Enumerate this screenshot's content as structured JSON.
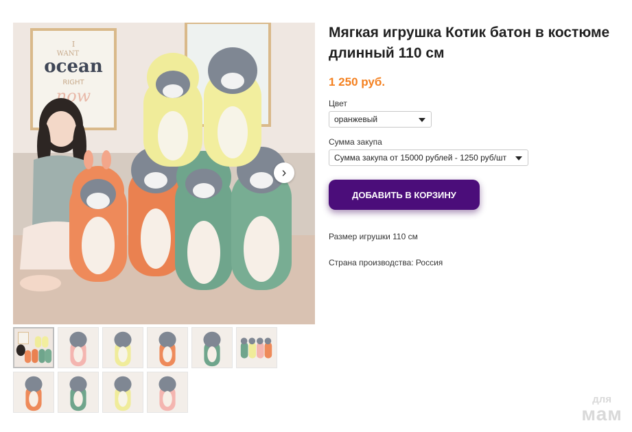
{
  "product": {
    "title": "Мягкая игрушка Котик батон в костюме длинный 110 см",
    "price": "1 250 руб.",
    "color_label": "Цвет",
    "color_value": "оранжевый",
    "sum_label": "Сумма закупа",
    "sum_value": "Сумма закупа от 15000 рублей - 1250 руб/шт",
    "add_to_cart": "ДОБАВИТЬ В КОРЗИНУ",
    "size_text": "Размер игрушки 110 см",
    "country_text": "Страна производства: Россия"
  },
  "gallery": {
    "poster_lines": [
      "I",
      "WANT",
      "ocean",
      "RIGHT",
      "now"
    ],
    "thumb_count": 10,
    "active_thumb": 1,
    "thumbs": [
      "all-cats",
      "pink-cat",
      "yellow-cat",
      "orange-cat",
      "green-cat",
      "four-cats",
      "orange-cat",
      "green-cat",
      "yellow-cat",
      "pink-cat"
    ]
  },
  "watermark": {
    "line1": "для",
    "line2": "мам"
  },
  "colors": {
    "accent_price": "#f4801f",
    "button": "#4b0d7a",
    "orange_suit": "#ee8a5a",
    "green_suit": "#6fa58c",
    "yellow_suit": "#f0ec9a",
    "pink_suit": "#f4b5b0"
  }
}
